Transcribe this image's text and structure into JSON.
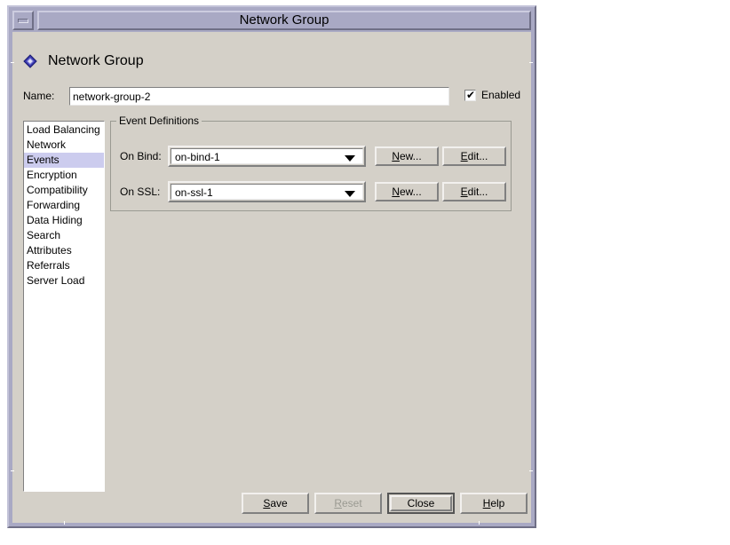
{
  "window": {
    "title": "Network Group",
    "minimize_icon": "minimize-icon"
  },
  "header": {
    "icon": "blue-diamond-icon",
    "title": "Network Group"
  },
  "name_row": {
    "label": "Name:",
    "value": "network-group-2",
    "placeholder": "",
    "enabled_label": "Enabled",
    "enabled_checked": true,
    "check_glyph": "✔"
  },
  "sidebar": {
    "selected": "Events",
    "items": [
      {
        "label": "Load Balancing"
      },
      {
        "label": "Network"
      },
      {
        "label": "Events"
      },
      {
        "label": "Encryption"
      },
      {
        "label": "Compatibility"
      },
      {
        "label": "Forwarding"
      },
      {
        "label": "Data Hiding"
      },
      {
        "label": "Search"
      },
      {
        "label": "Attributes"
      },
      {
        "label": "Referrals"
      },
      {
        "label": "Server Load"
      }
    ]
  },
  "event_group": {
    "title": "Event Definitions",
    "rows": [
      {
        "label": "On Bind:",
        "value": "on-bind-1",
        "new_label": "New...",
        "new_mnemonic": "N",
        "edit_label": "Edit...",
        "edit_mnemonic": "E"
      },
      {
        "label": "On SSL:",
        "value": "on-ssl-1",
        "new_label": "New...",
        "new_mnemonic": "N",
        "edit_label": "Edit...",
        "edit_mnemonic": "E"
      }
    ]
  },
  "buttons": {
    "save": {
      "label": "Save",
      "mnemonic": "S",
      "rest": "ave",
      "enabled": true
    },
    "reset": {
      "label": "Reset",
      "mnemonic": "R",
      "rest": "eset",
      "enabled": false
    },
    "close": {
      "label": "Close",
      "mnemonic": "",
      "rest": "Close",
      "enabled": true,
      "default": true
    },
    "help": {
      "label": "Help",
      "mnemonic": "H",
      "rest": "elp",
      "enabled": true
    }
  },
  "colors": {
    "titlebar": "#a9a9c4",
    "frame": "#a9a9c4",
    "dialog_bg": "#d4d0c8",
    "selection": "#ccccee",
    "accent_icon": "#3b3bb0",
    "field_bg": "#ffffff",
    "disabled_text": "#9a9a92"
  }
}
